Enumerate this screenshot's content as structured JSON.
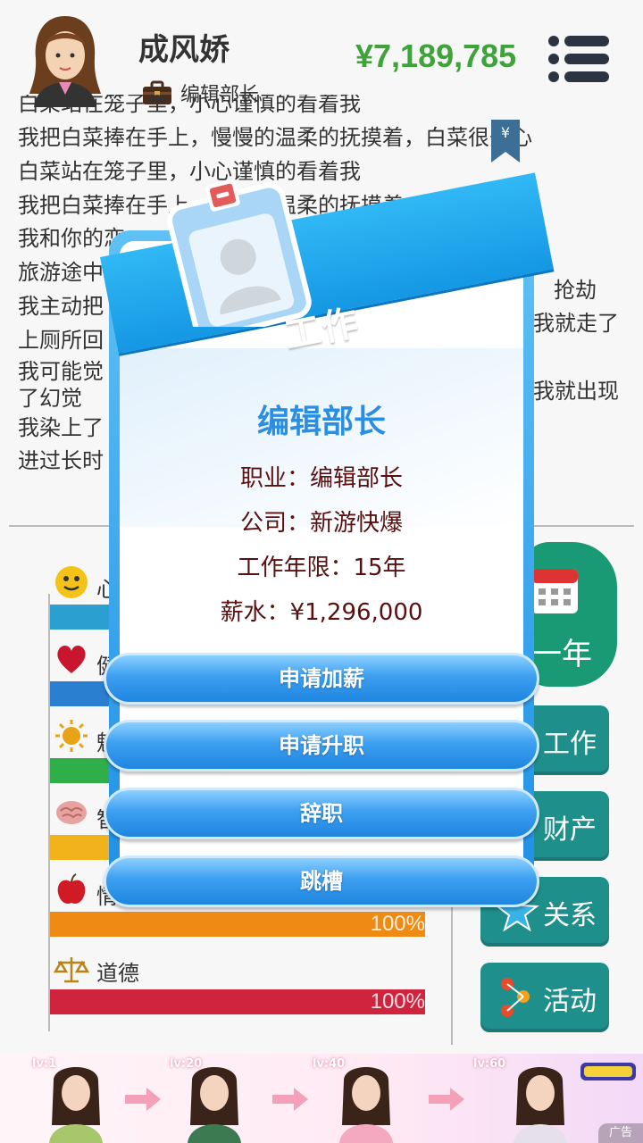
{
  "header": {
    "name": "成风娇",
    "job": "编辑部长",
    "money": "¥7,189,785"
  },
  "story": {
    "lines": [
      "白菜站在笼子里，小心谨慎的看着我",
      "我把白菜捧在手上，慢慢的温柔的抚摸着，白菜很开心",
      "白菜站在笼子里，小心谨慎的看着我",
      "我把白菜捧在手上，慢慢的温柔的抚摸着，白菜很开心",
      "我和你的恋",
      "旅游途中",
      "我主动把",
      "上厕所回",
      "我可能觉",
      "了幻觉",
      "我染上了",
      "进过长时"
    ],
    "right_fragments": [
      "抢劫",
      "我就走了",
      "我就出现"
    ]
  },
  "stats": [
    {
      "label": "心",
      "icon": "smiley-icon",
      "color": "#2a9fd0",
      "value": "",
      "level": 1.0
    },
    {
      "label": "健",
      "icon": "heart-icon",
      "color": "#2b7fd0",
      "value": "",
      "level": 1.0
    },
    {
      "label": "魅",
      "icon": "sun-icon",
      "color": "#2fae4a",
      "value": "",
      "level": 1.0
    },
    {
      "label": "智",
      "icon": "brain-icon",
      "color": "#f2b21c",
      "value": "",
      "level": 1.0
    },
    {
      "label": "情",
      "icon": "apple-icon",
      "color": "#ef8a12",
      "value": "100%",
      "level": 1.0
    },
    {
      "label": "道德",
      "icon": "scale-icon",
      "color": "#d0243e",
      "value": "100%",
      "level": 1.0
    }
  ],
  "side_buttons": {
    "next_year": "一年",
    "work": "工作",
    "assets": "财产",
    "relations": "关系",
    "activities": "活动"
  },
  "ad": {
    "levels": [
      "lv:1",
      "lv:20",
      "lv:40",
      "lv:60"
    ],
    "close_label": "广告"
  },
  "modal": {
    "ribbon_title": "工作",
    "job_title": "编辑部长",
    "occupation": "职业：编辑部长",
    "company": "公司：新游快爆",
    "years": "工作年限：15年",
    "salary": "薪水：¥1,296,000",
    "buttons": [
      "申请加薪",
      "申请升职",
      "辞职",
      "跳槽"
    ]
  },
  "colors": {
    "money": "#3fa23a",
    "modal_accent": "#2a8ee3",
    "teal_button": "#1f8f8b"
  }
}
